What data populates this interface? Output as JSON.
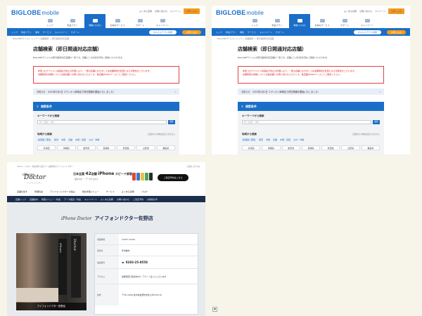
{
  "biglobe": {
    "logo_main": "BIGLOBE",
    "logo_sub": "mobile",
    "top_links": [
      "よくある質問",
      "お問い合わせ",
      "マイページ"
    ],
    "top_button": "お申し込み",
    "nav": [
      {
        "label": "トップ",
        "active": false
      },
      {
        "label": "料金プラン",
        "active": false
      },
      {
        "label": "端末(スマホ)",
        "active": true
      },
      {
        "label": "お得なサービス",
        "active": false
      },
      {
        "label": "サポート",
        "active": false
      },
      {
        "label": "キャンペーン",
        "active": false
      }
    ],
    "subnav": [
      "トップ",
      "料金プラン",
      "端末",
      "サービス",
      "キャンペーン",
      "サポート",
      "よくある質問"
    ],
    "subnav_pill": "かんたんアプリ比較",
    "subnav_apply": "お申し込み",
    "breadcrumb": "BIGLOBEモバイル トップ > 店舗検索 > 即日開通対応店舗",
    "heading": "店舗検索（即日開通対応店舗）",
    "description": "BIGLOBEモバイルの即日開通対応店舗の一覧です。店舗ごとの対応状況をご確認いただけます。",
    "alert_lines": [
      "新型コロナウイルス感染拡大防止の影響により、一部の店舗におきましては営業時間が変更になる可能性がございます。",
      "営業時間の詳細については各店舗へお問い合わせいただくか、各店舗のWebページにてご確認ください。"
    ],
    "notice": "お知らせ　2022年2月1日 エディオン姉崎店で即日開通を開始いたしました！",
    "conditions_title": "検索条件",
    "keyword_label": "キーワードから検索",
    "keyword_placeholder": "例）店舗名、住所",
    "keyword_button": "検索",
    "region_label": "地域から検索",
    "region_note": "店舗がない地域は表示されません",
    "region_tabs": [
      "北海道・東北",
      "関東",
      "中部",
      "近畿",
      "中国・四国",
      "九州・沖縄"
    ],
    "prefectures": [
      "北海道",
      "青森県",
      "岩手県",
      "宮城県",
      "秋田県",
      "山形県",
      "福島県"
    ]
  },
  "doctor": {
    "top_line_left": "iPhone・スマホ・端末修理 店舗 ゲーム機修理のアイフォンドクター",
    "top_line_right": "店舗をさがす ▶",
    "logo_small": "iPhone",
    "logo_big": "Doctor",
    "logo_tag": "アイフォンドクター",
    "ad_prefix": "日本全国",
    "ad_count": "42",
    "ad_unit": "店舗",
    "ad_product": "iPhone",
    "ad_suffix": "スピード修理",
    "ad_sub": "最短30分 ・ データそのまま",
    "phone_colors": [
      "#e1473b",
      "#3a78c9",
      "#e8c046",
      "#4aa658",
      "#2b2b2b"
    ],
    "cta": "ご来店予約はこちら",
    "menu": [
      "店舗を探す",
      "修理料金",
      "アイフォンドクターの強み",
      "他社修理メニュー",
      "サービス",
      "よくある質問",
      "ブログ"
    ],
    "bar": [
      "店舗トップ",
      "店舗案内",
      "修理メニュー・料金",
      "データ復旧・料金",
      "キャンペーン",
      "よくある質問",
      "お問い合わせ",
      "ご来店予約",
      "お客様の声"
    ],
    "store_logo": "iPhone Doctor",
    "store_title": "アイフォンドクター佐野店",
    "banner_text_1": "iPhone",
    "banner_text_2": "Doctor",
    "photo_caption": "アイフォンドクター佐野店",
    "info": [
      {
        "key": "営業時間",
        "value": "10:00〜19:00",
        "type": "text"
      },
      {
        "key": "定休日",
        "value": "年中無休",
        "type": "text"
      },
      {
        "key": "電話番号",
        "value": "0283-25-8558",
        "type": "tel"
      },
      {
        "key": "アクセス",
        "value": "佐野駅南口徒歩約5分・アパート近くにございます",
        "type": "text"
      },
      {
        "key": "住所",
        "value": "〒327-0025 栃木県佐野市金井上町2278-10",
        "type": "text"
      }
    ]
  }
}
